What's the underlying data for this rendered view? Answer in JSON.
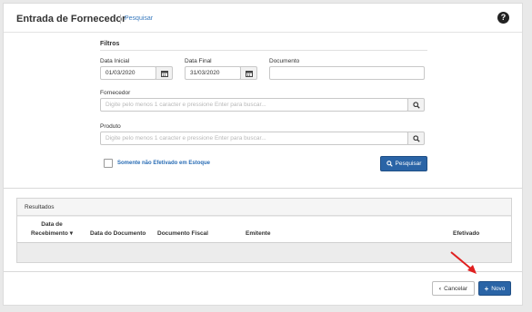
{
  "header": {
    "title": "Entrada de Fornecedor",
    "search_link": "Pesquisar",
    "help_icon": "question-circle-icon"
  },
  "filters": {
    "title": "Filtros",
    "data_inicial_label": "Data Inicial",
    "data_inicial_value": "01/03/2020",
    "data_final_label": "Data Final",
    "data_final_value": "31/03/2020",
    "documento_label": "Documento",
    "documento_value": "",
    "fornecedor_label": "Fornecedor",
    "fornecedor_placeholder": "Digite pelo menos 1 caracter e pressione Enter para buscar...",
    "produto_label": "Produto",
    "produto_placeholder": "Digite pelo menos 1 caracter e pressione Enter para buscar...",
    "checkbox_label": "Somente não Efetivado em Estoque",
    "checkbox_checked": false,
    "search_button": "Pesquisar"
  },
  "results": {
    "title": "Resultados",
    "columns": {
      "data_recebimento_line1": "Data de",
      "data_recebimento_line2": "Recebimento",
      "data_documento": "Data do Documento",
      "documento_fiscal": "Documento Fiscal",
      "emitente": "Emitente",
      "efetivado": "Efetivado"
    },
    "rows": []
  },
  "footer": {
    "cancel_button": "Cancelar",
    "new_button": "Novo"
  },
  "colors": {
    "primary": "#2a64a6",
    "link": "#3a7bbf",
    "annotation_arrow": "#e02020"
  }
}
